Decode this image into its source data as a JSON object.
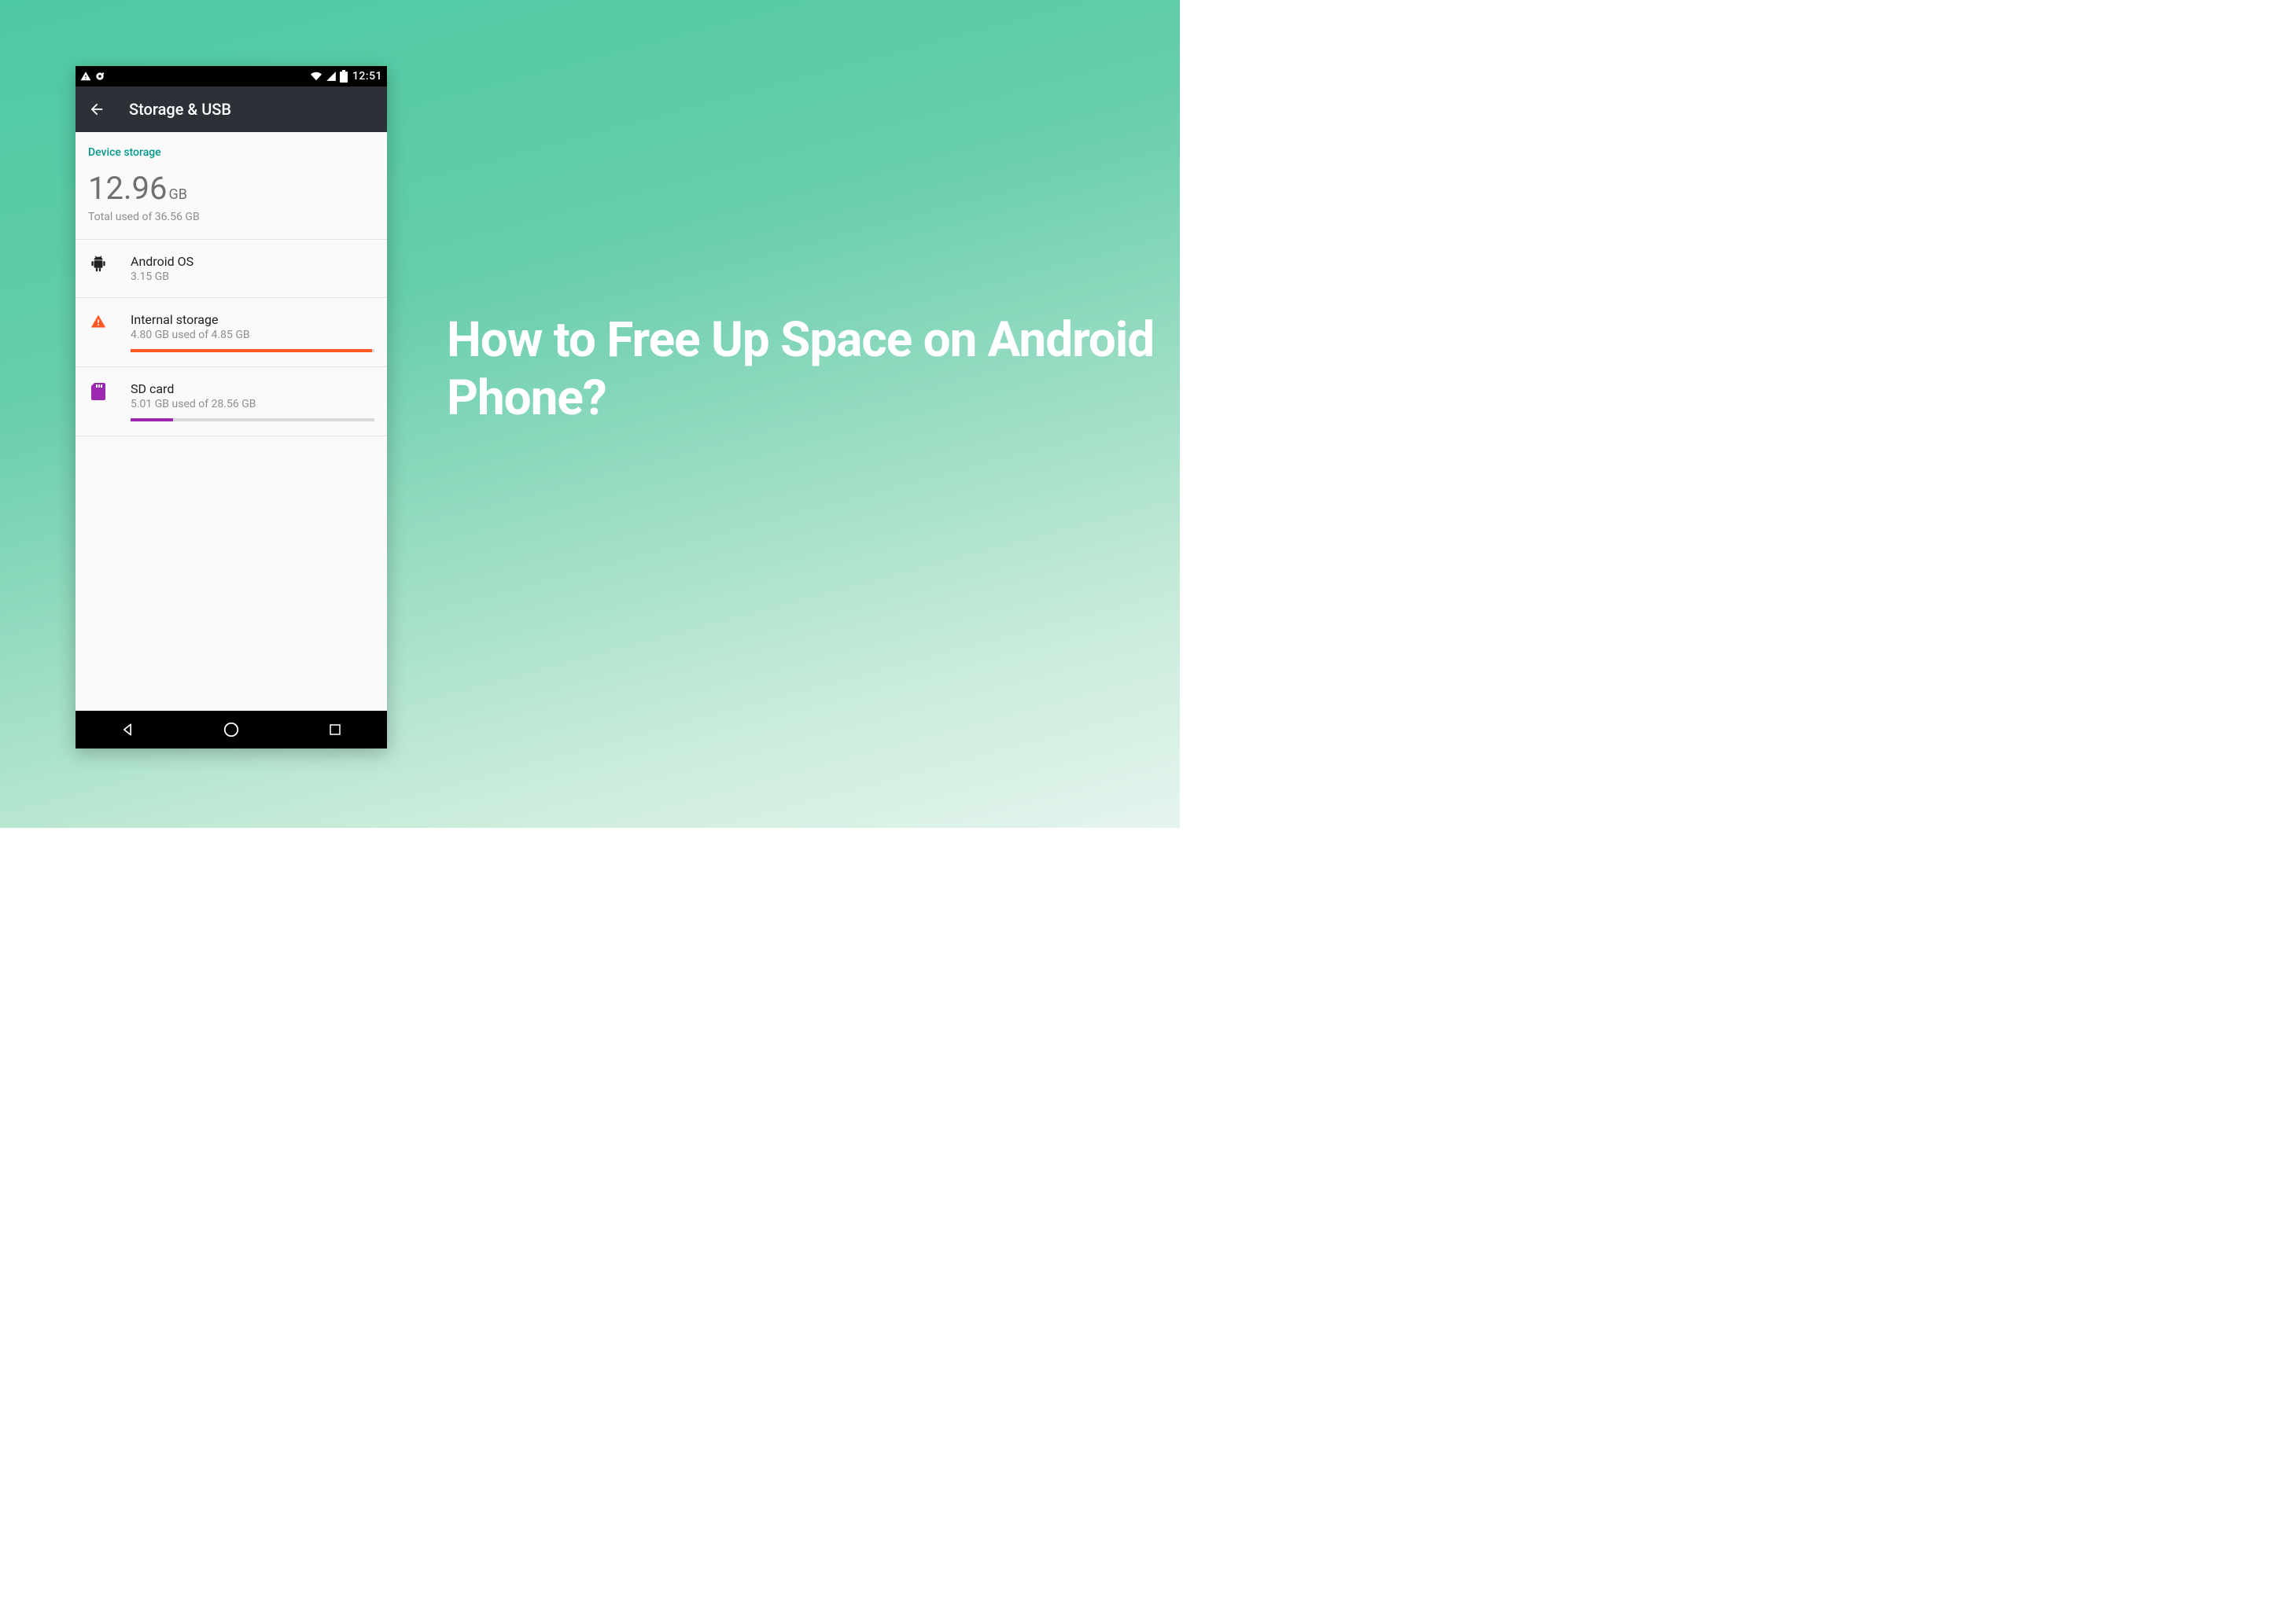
{
  "headline": "How to Free Up Space on Android Phone?",
  "status_bar": {
    "time": "12:51"
  },
  "app_bar": {
    "title": "Storage & USB"
  },
  "section": {
    "header": "Device storage"
  },
  "total": {
    "value": "12.96",
    "unit": "GB",
    "sub": "Total used of 36.56 GB"
  },
  "rows": {
    "os": {
      "title": "Android OS",
      "sub": "3.15 GB"
    },
    "internal": {
      "title": "Internal storage",
      "sub": "4.80 GB used of 4.85 GB",
      "fill_pct": "99%"
    },
    "sd": {
      "title": "SD card",
      "sub": "5.01 GB used of 28.56 GB",
      "fill_pct": "17.5%"
    }
  }
}
